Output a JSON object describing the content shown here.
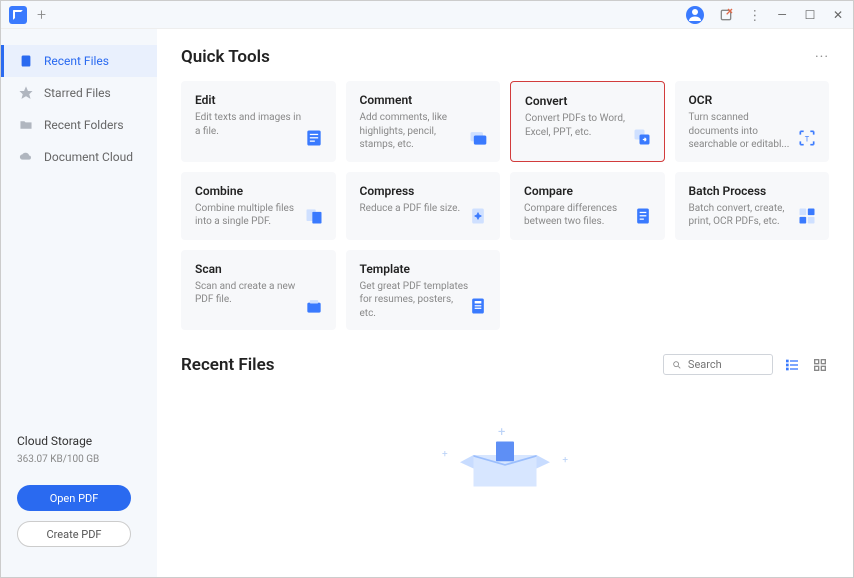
{
  "titlebar": {
    "add_label": "+"
  },
  "window_controls": {
    "minimize": "—",
    "maximize": "☐",
    "close": "✕"
  },
  "sidebar": {
    "items": [
      {
        "label": "Recent Files"
      },
      {
        "label": "Starred Files"
      },
      {
        "label": "Recent Folders"
      },
      {
        "label": "Document Cloud"
      }
    ],
    "cloud_label": "Cloud Storage",
    "cloud_usage": "363.07 KB/100 GB",
    "open_label": "Open PDF",
    "create_label": "Create PDF"
  },
  "quick_tools": {
    "title": "Quick Tools",
    "more": "···",
    "cards": [
      {
        "title": "Edit",
        "desc": "Edit texts and images in a file."
      },
      {
        "title": "Comment",
        "desc": "Add comments, like highlights, pencil, stamps, etc."
      },
      {
        "title": "Convert",
        "desc": "Convert PDFs to Word, Excel, PPT, etc."
      },
      {
        "title": "OCR",
        "desc": "Turn scanned documents into searchable or editabl..."
      },
      {
        "title": "Combine",
        "desc": "Combine multiple files into a single PDF."
      },
      {
        "title": "Compress",
        "desc": "Reduce a PDF file size."
      },
      {
        "title": "Compare",
        "desc": "Compare differences between two files."
      },
      {
        "title": "Batch Process",
        "desc": "Batch convert, create, print, OCR PDFs, etc."
      },
      {
        "title": "Scan",
        "desc": "Scan and create a new PDF file."
      },
      {
        "title": "Template",
        "desc": "Get great PDF templates for resumes, posters, etc."
      }
    ]
  },
  "recent": {
    "title": "Recent Files",
    "search_placeholder": "Search"
  }
}
